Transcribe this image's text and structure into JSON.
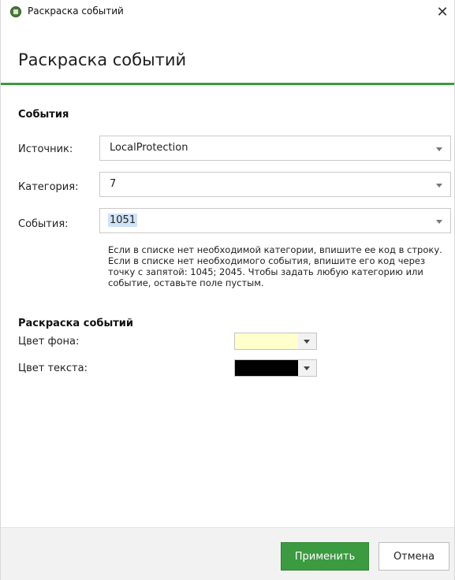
{
  "window": {
    "title": "Раскраска событий",
    "close_glyph": "✕"
  },
  "header": {
    "title": "Раскраска событий"
  },
  "events_section": {
    "title": "События",
    "source": {
      "label": "Источник:",
      "value": "LocalProtection"
    },
    "category": {
      "label": "Категория:",
      "value": "7"
    },
    "events": {
      "label": "События:",
      "value": "1051"
    },
    "hint": "Если в списке нет необходимой категории, впишите ее код в строку. Если в списке нет необходимого события, впишите его код через точку с запятой: 1045; 2045. Чтобы задать любую категорию или событие, оставьте поле пустым."
  },
  "coloring_section": {
    "title": "Раскраска событий",
    "background": {
      "label": "Цвет фона:",
      "color": "#ffffcc"
    },
    "text": {
      "label": "Цвет текста:",
      "color": "#000000"
    }
  },
  "footer": {
    "apply_label": "Применить",
    "cancel_label": "Отмена"
  },
  "colors": {
    "accent": "#3a9a3e",
    "selection": "#cfe3f7"
  }
}
